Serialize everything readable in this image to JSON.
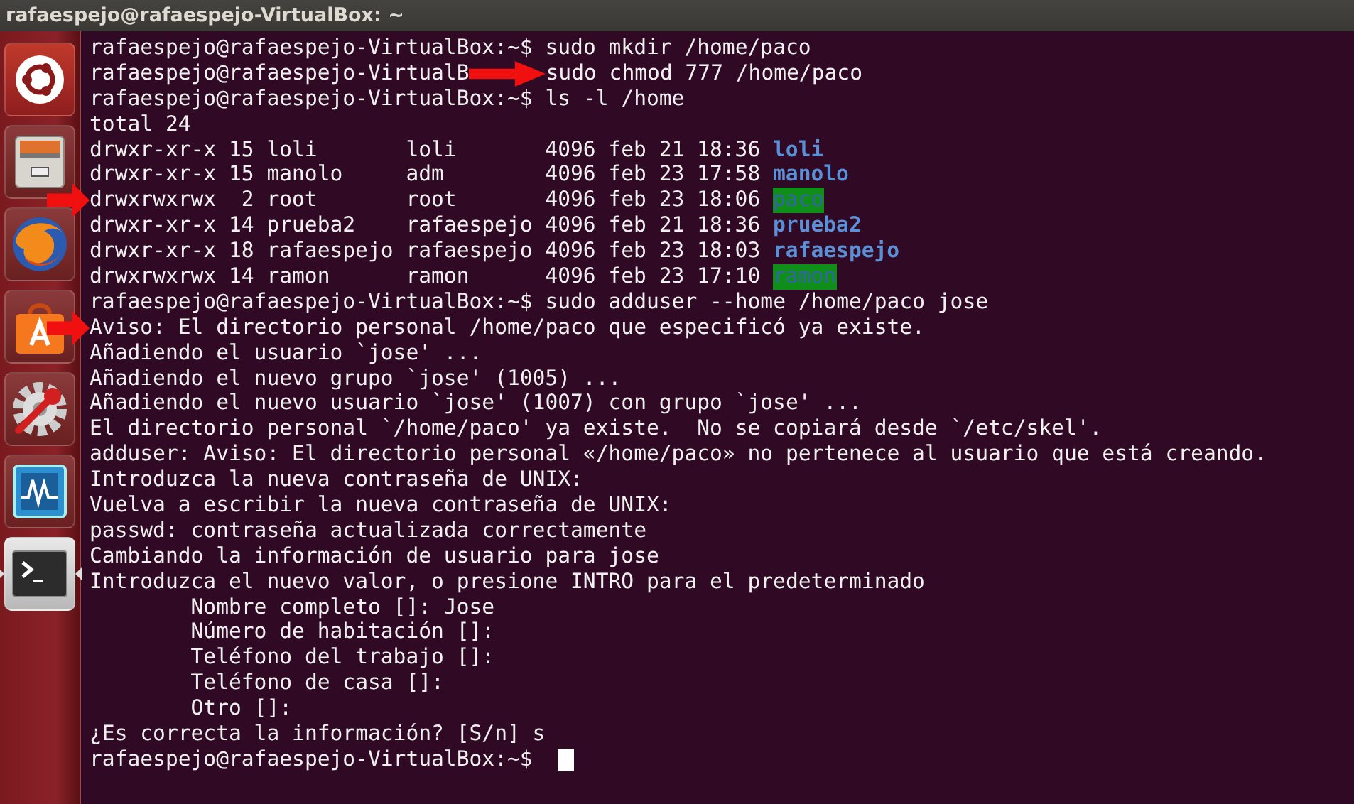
{
  "window": {
    "title": "rafaespejo@rafaespejo-VirtualBox: ~"
  },
  "launcher": [
    {
      "kind": "dash",
      "selected": false
    },
    {
      "kind": "files",
      "selected": false
    },
    {
      "kind": "browser",
      "selected": false
    },
    {
      "kind": "store",
      "selected": false
    },
    {
      "kind": "settings",
      "selected": false
    },
    {
      "kind": "monitor",
      "selected": false
    },
    {
      "kind": "terminal",
      "selected": true
    }
  ],
  "terminal": {
    "lines": [
      {
        "kind": "prompt",
        "prompt": "rafaespejo@rafaespejo-VirtualBox:~$",
        "command": "sudo mkdir /home/paco"
      },
      {
        "kind": "prompt",
        "prompt": "rafaespejo@rafaespejo-VirtualB",
        "command": "sudo chmod 777 /home/paco",
        "arrow": true
      },
      {
        "kind": "prompt",
        "prompt": "rafaespejo@rafaespejo-VirtualBox:~$",
        "command": "ls -l /home"
      },
      {
        "kind": "output",
        "text": "total 24"
      },
      {
        "kind": "listing",
        "perms": "drwxr-xr-x",
        "links": "15",
        "owner": "loli",
        "group": "loli",
        "size": "4096",
        "date": "feb 21 18:36",
        "name": "loli",
        "writable": false
      },
      {
        "kind": "listing",
        "perms": "drwxr-xr-x",
        "links": "15",
        "owner": "manolo",
        "group": "adm",
        "size": "4096",
        "date": "feb 23 17:58",
        "name": "manolo",
        "writable": false
      },
      {
        "kind": "listing",
        "perms": "drwxrwxrwx",
        "links": "2",
        "owner": "root",
        "group": "root",
        "size": "4096",
        "date": "feb 23 18:06",
        "name": "paco",
        "writable": true,
        "arrow": true
      },
      {
        "kind": "listing",
        "perms": "drwxr-xr-x",
        "links": "14",
        "owner": "prueba2",
        "group": "rafaespejo",
        "size": "4096",
        "date": "feb 21 18:36",
        "name": "prueba2",
        "writable": false
      },
      {
        "kind": "listing",
        "perms": "drwxr-xr-x",
        "links": "18",
        "owner": "rafaespejo",
        "group": "rafaespejo",
        "size": "4096",
        "date": "feb 23 18:03",
        "name": "rafaespejo",
        "writable": false
      },
      {
        "kind": "listing",
        "perms": "drwxrwxrwx",
        "links": "14",
        "owner": "ramon",
        "group": "ramon",
        "size": "4096",
        "date": "feb 23 17:10",
        "name": "ramon",
        "writable": true
      },
      {
        "kind": "prompt",
        "prompt": "rafaespejo@rafaespejo-VirtualBox:~$",
        "command": "sudo adduser --home /home/paco jose"
      },
      {
        "kind": "output",
        "text": "Aviso: El directorio personal /home/paco que especificó ya existe.",
        "arrow": true
      },
      {
        "kind": "output",
        "text": "Añadiendo el usuario `jose' ..."
      },
      {
        "kind": "output",
        "text": "Añadiendo el nuevo grupo `jose' (1005) ..."
      },
      {
        "kind": "output",
        "text": "Añadiendo el nuevo usuario `jose' (1007) con grupo `jose' ..."
      },
      {
        "kind": "output",
        "text": "El directorio personal `/home/paco' ya existe.  No se copiará desde `/etc/skel'."
      },
      {
        "kind": "output",
        "text": "adduser: Aviso: El directorio personal «/home/paco» no pertenece al usuario que está creando."
      },
      {
        "kind": "output",
        "text": "Introduzca la nueva contraseña de UNIX:"
      },
      {
        "kind": "output",
        "text": "Vuelva a escribir la nueva contraseña de UNIX:"
      },
      {
        "kind": "output",
        "text": "passwd: contraseña actualizada correctamente"
      },
      {
        "kind": "output",
        "text": "Cambiando la información de usuario para jose"
      },
      {
        "kind": "output",
        "text": "Introduzca el nuevo valor, o presione INTRO para el predeterminado"
      },
      {
        "kind": "indented",
        "text": "Nombre completo []: Jose"
      },
      {
        "kind": "indented",
        "text": "Número de habitación []:"
      },
      {
        "kind": "indented",
        "text": "Teléfono del trabajo []:"
      },
      {
        "kind": "indented",
        "text": "Teléfono de casa []:"
      },
      {
        "kind": "indented",
        "text": "Otro []:"
      },
      {
        "kind": "output",
        "text": "¿Es correcta la información? [S/n] s"
      },
      {
        "kind": "prompt",
        "prompt": "rafaespejo@rafaespejo-VirtualBox:~$",
        "cursor": true
      }
    ]
  }
}
